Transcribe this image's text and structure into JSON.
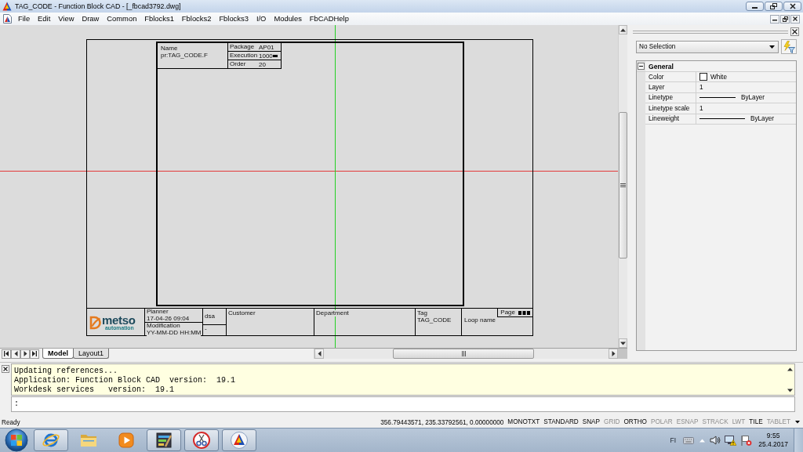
{
  "window": {
    "title": "TAG_CODE - Function Block CAD - [_fbcad3792.dwg]"
  },
  "menu": {
    "items": [
      "File",
      "Edit",
      "View",
      "Draw",
      "Common",
      "Fblocks1",
      "Fblocks2",
      "Fblocks3",
      "I/O",
      "Modules",
      "FbCADHelp"
    ]
  },
  "drawing": {
    "header_block": {
      "name_label": "Name",
      "name": "pr:TAG_CODE.F",
      "fields": [
        {
          "label": "Package",
          "value": "AP01",
          "kind": "text"
        },
        {
          "label": "Execution",
          "value": "1000",
          "kind": "text_block"
        },
        {
          "label": "Order",
          "value": "20",
          "kind": "text"
        }
      ]
    },
    "title_block": {
      "logo": {
        "name": "metso",
        "tagline": "automation"
      },
      "planner_label": "Planner",
      "planner": "17-04-26 09:04",
      "modification_label": "Modification",
      "modification": "YY-MM-DD HH:MM",
      "date_label": "dsa",
      "date": "-",
      "customer_label": "Customer",
      "department_label": "Department",
      "tag_label": "Tag",
      "tag": "TAG_CODE",
      "loop_label": "Loop name",
      "page_label": "Page"
    }
  },
  "layout_tabs": [
    {
      "label": "Model",
      "selected": true
    },
    {
      "label": "Layout1",
      "selected": false
    }
  ],
  "properties": {
    "selection": "No Selection",
    "section": {
      "title": "General",
      "expanded": true
    },
    "rows": [
      {
        "name": "Color",
        "value": "White",
        "kind": "color"
      },
      {
        "name": "Layer",
        "value": "1",
        "kind": "text"
      },
      {
        "name": "Linetype",
        "value": "ByLayer",
        "kind": "linetype"
      },
      {
        "name": "Linetype scale",
        "value": "1",
        "kind": "text"
      },
      {
        "name": "Lineweight",
        "value": "ByLayer",
        "kind": "lineweight"
      }
    ]
  },
  "command": {
    "lines": [
      "Updating references...",
      "Application: Function Block CAD  version:  19.1",
      "Workdesk services   version:  19.1"
    ],
    "prompt": ":"
  },
  "status_bar": {
    "text": "Ready",
    "coordinates": "356.79443571, 235.33792561, 0.00000000",
    "toggles": [
      {
        "label": "MONOTXT",
        "on": true
      },
      {
        "label": "STANDARD",
        "on": true
      },
      {
        "label": "SNAP",
        "on": true
      },
      {
        "label": "GRID",
        "on": false
      },
      {
        "label": "ORTHO",
        "on": true
      },
      {
        "label": "POLAR",
        "on": false
      },
      {
        "label": "ESNAP",
        "on": false
      },
      {
        "label": "STRACK",
        "on": false
      },
      {
        "label": "LWT",
        "on": false
      },
      {
        "label": "TILE",
        "on": true
      },
      {
        "label": "TABLET",
        "on": false
      }
    ]
  },
  "taskbar": {
    "apps": [
      {
        "kind": "browser",
        "running": true
      },
      {
        "kind": "folder",
        "running": false
      },
      {
        "kind": "player",
        "running": false
      },
      {
        "kind": "tile",
        "running": true
      },
      {
        "kind": "scissors",
        "running": true
      },
      {
        "kind": "cad",
        "running": true
      }
    ],
    "tray": {
      "language": "FI",
      "time": "9:55",
      "date": "25.4.2017"
    }
  }
}
